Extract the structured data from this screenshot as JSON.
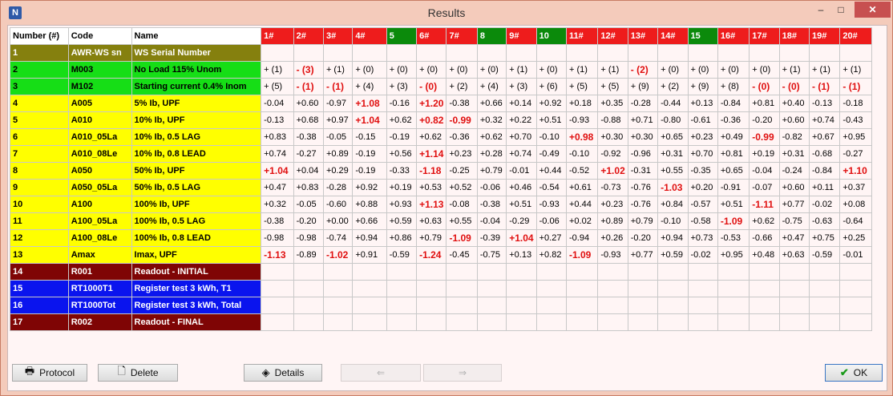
{
  "window": {
    "title": "Results"
  },
  "columns": {
    "number": "Number (#)",
    "code": "Code",
    "name": "Name",
    "results": [
      {
        "label": "1#",
        "color": "red"
      },
      {
        "label": "2#",
        "color": "red"
      },
      {
        "label": "3#",
        "color": "red"
      },
      {
        "label": "4#",
        "color": "red"
      },
      {
        "label": "5",
        "color": "green"
      },
      {
        "label": "6#",
        "color": "red"
      },
      {
        "label": "7#",
        "color": "red"
      },
      {
        "label": "8",
        "color": "green"
      },
      {
        "label": "9#",
        "color": "red"
      },
      {
        "label": "10",
        "color": "green"
      },
      {
        "label": "11#",
        "color": "red"
      },
      {
        "label": "12#",
        "color": "red"
      },
      {
        "label": "13#",
        "color": "red"
      },
      {
        "label": "14#",
        "color": "red"
      },
      {
        "label": "15",
        "color": "green"
      },
      {
        "label": "16#",
        "color": "red"
      },
      {
        "label": "17#",
        "color": "red"
      },
      {
        "label": "18#",
        "color": "red"
      },
      {
        "label": "19#",
        "color": "red"
      },
      {
        "label": "20#",
        "color": "red"
      }
    ]
  },
  "row_colors": {
    "olive": "#85800e",
    "green": "#16de16",
    "yellow": "#ffff00",
    "maroon": "#7f0505",
    "blue": "#0a14ee"
  },
  "rows": [
    {
      "num": "1",
      "code": "AWR-WS sn",
      "name": "WS Serial Number",
      "color": "olive",
      "text": "#ffffff",
      "cells": [
        "",
        "",
        "",
        "",
        "",
        "",
        "",
        "",
        "",
        "",
        "",
        "",
        "",
        "",
        "",
        "",
        "",
        "",
        "",
        ""
      ]
    },
    {
      "num": "2",
      "code": "M003",
      "name": "No Load 115% Unom",
      "color": "green",
      "text": "#000000",
      "cells": [
        "+ (1)",
        "- (3)",
        "+ (1)",
        "+ (0)",
        "+ (0)",
        "+ (0)",
        "+ (0)",
        "+ (0)",
        "+ (1)",
        "+ (0)",
        "+ (1)",
        "+ (1)",
        "- (2)",
        "+ (0)",
        "+ (0)",
        "+ (0)",
        "+ (0)",
        "+ (1)",
        "+ (1)",
        "+ (1)"
      ],
      "bad": [
        1,
        12
      ]
    },
    {
      "num": "3",
      "code": "M102",
      "name": "Starting current 0.4% Inom",
      "color": "green",
      "text": "#000000",
      "cells": [
        "+ (5)",
        "- (1)",
        "- (1)",
        "+ (4)",
        "+ (3)",
        "- (0)",
        "+ (2)",
        "+ (4)",
        "+ (3)",
        "+ (6)",
        "+ (5)",
        "+ (5)",
        "+ (9)",
        "+ (2)",
        "+ (9)",
        "+ (8)",
        "- (0)",
        "- (0)",
        "- (1)",
        "- (1)"
      ],
      "bad": [
        1,
        2,
        5,
        16,
        17,
        18,
        19
      ]
    },
    {
      "num": "4",
      "code": "A005",
      "name": "5% Ib, UPF",
      "color": "yellow",
      "text": "#000000",
      "cells": [
        "-0.04",
        "+0.60",
        "-0.97",
        "+1.08",
        "-0.16",
        "+1.20",
        "-0.38",
        "+0.66",
        "+0.14",
        "+0.92",
        "+0.18",
        "+0.35",
        "-0.28",
        "-0.44",
        "+0.13",
        "-0.84",
        "+0.81",
        "+0.40",
        "-0.13",
        "-0.18"
      ],
      "bad": [
        3,
        5
      ]
    },
    {
      "num": "5",
      "code": "A010",
      "name": "10% Ib, UPF",
      "color": "yellow",
      "text": "#000000",
      "cells": [
        "-0.13",
        "+0.68",
        "+0.97",
        "+1.04",
        "+0.62",
        "+0.82",
        "-0.99",
        "+0.32",
        "+0.22",
        "+0.51",
        "-0.93",
        "-0.88",
        "+0.71",
        "-0.80",
        "-0.61",
        "-0.36",
        "-0.20",
        "+0.60",
        "+0.74",
        "-0.43"
      ],
      "bad": [
        3,
        5,
        6
      ]
    },
    {
      "num": "6",
      "code": "A010_05La",
      "name": "10% Ib, 0.5 LAG",
      "color": "yellow",
      "text": "#000000",
      "cells": [
        "+0.83",
        "-0.38",
        "-0.05",
        "-0.15",
        "-0.19",
        "+0.62",
        "-0.36",
        "+0.62",
        "+0.70",
        "-0.10",
        "+0.98",
        "+0.30",
        "+0.30",
        "+0.65",
        "+0.23",
        "+0.49",
        "-0.99",
        "-0.82",
        "+0.67",
        "+0.95"
      ],
      "bad": [
        10,
        16
      ]
    },
    {
      "num": "7",
      "code": "A010_08Le",
      "name": "10% Ib, 0.8 LEAD",
      "color": "yellow",
      "text": "#000000",
      "cells": [
        "+0.74",
        "-0.27",
        "+0.89",
        "-0.19",
        "+0.56",
        "+1.14",
        "+0.23",
        "+0.28",
        "+0.74",
        "-0.49",
        "-0.10",
        "-0.92",
        "-0.96",
        "+0.31",
        "+0.70",
        "+0.81",
        "+0.19",
        "+0.31",
        "-0.68",
        "-0.27"
      ],
      "bad": [
        5
      ]
    },
    {
      "num": "8",
      "code": "A050",
      "name": "50% Ib, UPF",
      "color": "yellow",
      "text": "#000000",
      "cells": [
        "+1.04",
        "+0.04",
        "+0.29",
        "-0.19",
        "-0.33",
        "-1.18",
        "-0.25",
        "+0.79",
        "-0.01",
        "+0.44",
        "-0.52",
        "+1.02",
        "-0.31",
        "+0.55",
        "-0.35",
        "+0.65",
        "-0.04",
        "-0.24",
        "-0.84",
        "+1.10"
      ],
      "bad": [
        0,
        5,
        11,
        19
      ]
    },
    {
      "num": "9",
      "code": "A050_05La",
      "name": "50% Ib, 0.5 LAG",
      "color": "yellow",
      "text": "#000000",
      "cells": [
        "+0.47",
        "+0.83",
        "-0.28",
        "+0.92",
        "+0.19",
        "+0.53",
        "+0.52",
        "-0.06",
        "+0.46",
        "-0.54",
        "+0.61",
        "-0.73",
        "-0.76",
        "-1.03",
        "+0.20",
        "-0.91",
        "-0.07",
        "+0.60",
        "+0.11",
        "+0.37"
      ],
      "bad": [
        13
      ]
    },
    {
      "num": "10",
      "code": "A100",
      "name": "100% Ib, UPF",
      "color": "yellow",
      "text": "#000000",
      "cells": [
        "+0.32",
        "-0.05",
        "-0.60",
        "+0.88",
        "+0.93",
        "+1.13",
        "-0.08",
        "-0.38",
        "+0.51",
        "-0.93",
        "+0.44",
        "+0.23",
        "-0.76",
        "+0.84",
        "-0.57",
        "+0.51",
        "-1.11",
        "+0.77",
        "-0.02",
        "+0.08"
      ],
      "bad": [
        5,
        16
      ]
    },
    {
      "num": "11",
      "code": "A100_05La",
      "name": "100% Ib, 0.5 LAG",
      "color": "yellow",
      "text": "#000000",
      "cells": [
        "-0.38",
        "-0.20",
        "+0.00",
        "+0.66",
        "+0.59",
        "+0.63",
        "+0.55",
        "-0.04",
        "-0.29",
        "-0.06",
        "+0.02",
        "+0.89",
        "+0.79",
        "-0.10",
        "-0.58",
        "-1.09",
        "+0.62",
        "-0.75",
        "-0.63",
        "-0.64"
      ],
      "bad": [
        15
      ]
    },
    {
      "num": "12",
      "code": "A100_08Le",
      "name": "100% Ib, 0.8 LEAD",
      "color": "yellow",
      "text": "#000000",
      "cells": [
        "-0.98",
        "-0.98",
        "-0.74",
        "+0.94",
        "+0.86",
        "+0.79",
        "-1.09",
        "-0.39",
        "+1.04",
        "+0.27",
        "-0.94",
        "+0.26",
        "-0.20",
        "+0.94",
        "+0.73",
        "-0.53",
        "-0.66",
        "+0.47",
        "+0.75",
        "+0.25"
      ],
      "bad": [
        6,
        8
      ]
    },
    {
      "num": "13",
      "code": "Amax",
      "name": "Imax, UPF",
      "color": "yellow",
      "text": "#000000",
      "cells": [
        "-1.13",
        "-0.89",
        "-1.02",
        "+0.91",
        "-0.59",
        "-1.24",
        "-0.45",
        "-0.75",
        "+0.13",
        "+0.82",
        "-1.09",
        "-0.93",
        "+0.77",
        "+0.59",
        "-0.02",
        "+0.95",
        "+0.48",
        "+0.63",
        "-0.59",
        "-0.01"
      ],
      "bad": [
        0,
        2,
        5,
        10
      ]
    },
    {
      "num": "14",
      "code": "R001",
      "name": "Readout - INITIAL",
      "color": "maroon",
      "text": "#ffffff",
      "cells": [
        "",
        "",
        "",
        "",
        "",
        "",
        "",
        "",
        "",
        "",
        "",
        "",
        "",
        "",
        "",
        "",
        "",
        "",
        "",
        ""
      ]
    },
    {
      "num": "15",
      "code": "RT1000T1",
      "name": "Register test 3 kWh, T1",
      "color": "blue",
      "text": "#ffffff",
      "cells": [
        "",
        "",
        "",
        "",
        "",
        "",
        "",
        "",
        "",
        "",
        "",
        "",
        "",
        "",
        "",
        "",
        "",
        "",
        "",
        ""
      ]
    },
    {
      "num": "16",
      "code": "RT1000Tot",
      "name": "Register test 3 kWh, Total",
      "color": "blue",
      "text": "#ffffff",
      "cells": [
        "",
        "",
        "",
        "",
        "",
        "",
        "",
        "",
        "",
        "",
        "",
        "",
        "",
        "",
        "",
        "",
        "",
        "",
        "",
        ""
      ]
    },
    {
      "num": "17",
      "code": "R002",
      "name": "Readout - FINAL",
      "color": "maroon",
      "text": "#ffffff",
      "cells": [
        "",
        "",
        "",
        "",
        "",
        "",
        "",
        "",
        "",
        "",
        "",
        "",
        "",
        "",
        "",
        "",
        "",
        "",
        "",
        ""
      ]
    }
  ],
  "buttons": {
    "protocol": "Protocol",
    "delete": "Delete",
    "details": "Details",
    "prev": "⇐",
    "next": "⇒",
    "ok": "OK"
  }
}
